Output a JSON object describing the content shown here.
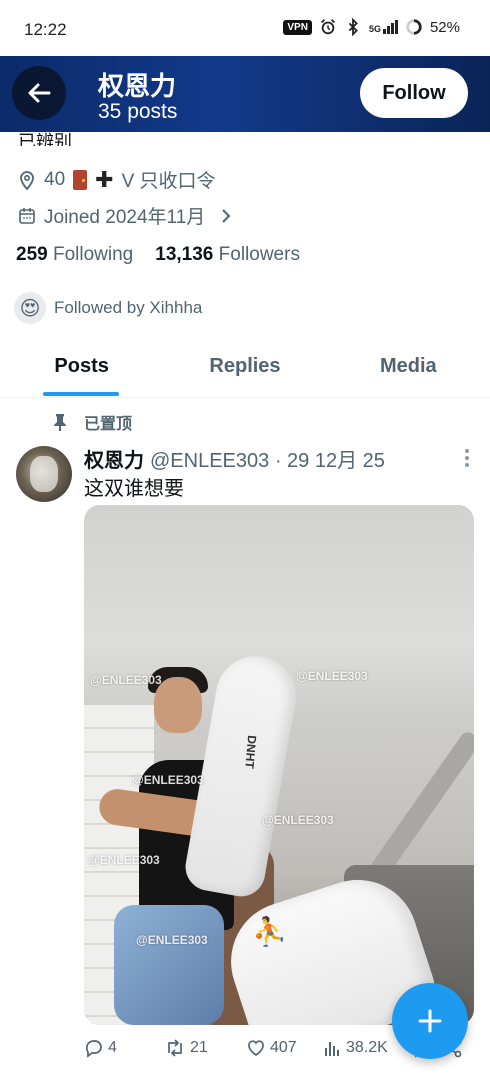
{
  "status_bar": {
    "time": "12:22",
    "vpn": "VPN",
    "network": "5G",
    "battery": "52%"
  },
  "header": {
    "name": "权恩力",
    "posts_count": "35 posts",
    "follow_label": "Follow"
  },
  "profile": {
    "bio_fragment": "已辨别",
    "location_prefix": "40",
    "location_suffix": "V 只收口令",
    "joined": "Joined 2024年11月",
    "following_count": "259",
    "following_label": "Following",
    "followers_count": "13,136",
    "followers_label": "Followers",
    "followed_by": "Followed by Xihhha"
  },
  "tabs": [
    {
      "label": "Posts",
      "active": true
    },
    {
      "label": "Replies",
      "active": false
    },
    {
      "label": "Media",
      "active": false
    }
  ],
  "tweet": {
    "pinned_label": "已置顶",
    "author_name": "权恩力",
    "handle_date": "@ENLEE303 · 29 12月 25",
    "text": "这双谁想要",
    "media_watermark": "@ENLEE303",
    "sock_text": "DNHT",
    "replies": "4",
    "reposts": "21",
    "likes": "407",
    "views": "38.2K"
  },
  "colors": {
    "accent": "#1d9bf0",
    "header_bg": "#123a8a",
    "text_primary": "#0f1419",
    "text_secondary": "#536471"
  }
}
